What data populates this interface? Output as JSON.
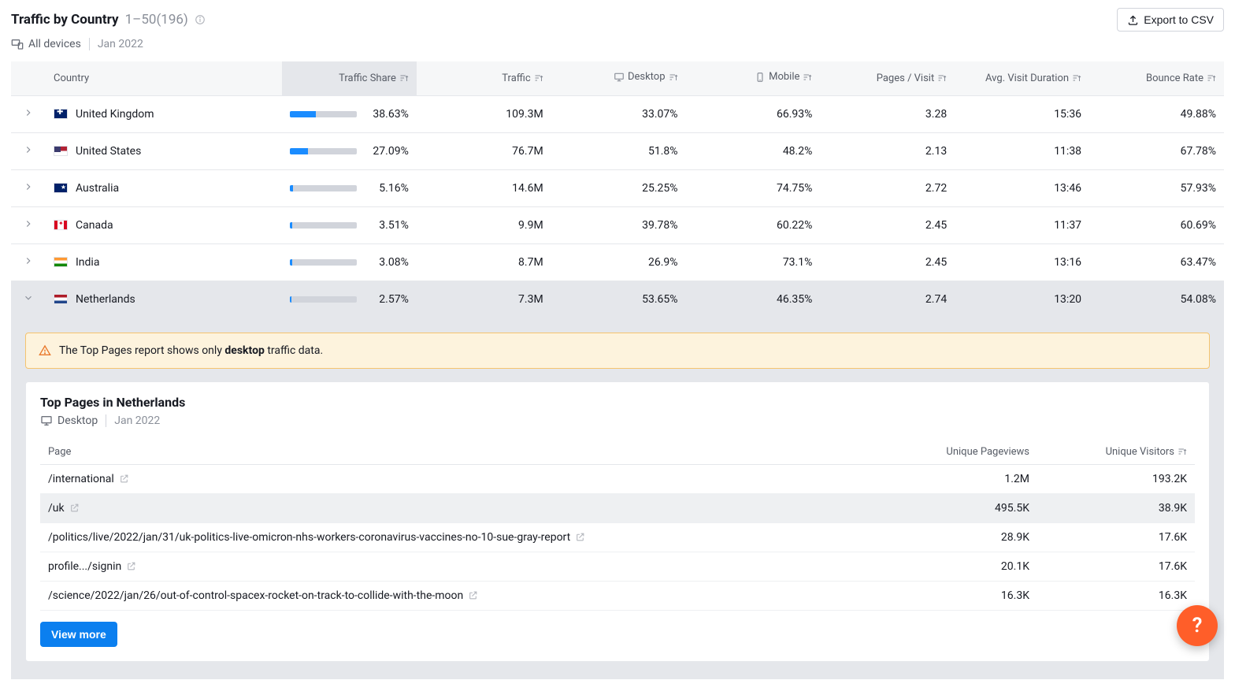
{
  "header": {
    "title": "Traffic by Country",
    "range": "1–50",
    "total": "(196)",
    "export_label": "Export to CSV",
    "device_label": "All devices",
    "date_label": "Jan 2022"
  },
  "columns": {
    "country": "Country",
    "share": "Traffic Share",
    "traffic": "Traffic",
    "desktop": "Desktop",
    "mobile": "Mobile",
    "pages_visit": "Pages / Visit",
    "avg_duration": "Avg. Visit Duration",
    "bounce": "Bounce Rate"
  },
  "rows": [
    {
      "flag": "gb",
      "country": "United Kingdom",
      "share_pct": 38.63,
      "share": "38.63%",
      "traffic": "109.3M",
      "desktop": "33.07%",
      "mobile": "66.93%",
      "pages_visit": "3.28",
      "avg_duration": "15:36",
      "bounce": "49.88%"
    },
    {
      "flag": "us",
      "country": "United States",
      "share_pct": 27.09,
      "share": "27.09%",
      "traffic": "76.7M",
      "desktop": "51.8%",
      "mobile": "48.2%",
      "pages_visit": "2.13",
      "avg_duration": "11:38",
      "bounce": "67.78%"
    },
    {
      "flag": "au",
      "country": "Australia",
      "share_pct": 5.16,
      "share": "5.16%",
      "traffic": "14.6M",
      "desktop": "25.25%",
      "mobile": "74.75%",
      "pages_visit": "2.72",
      "avg_duration": "13:46",
      "bounce": "57.93%"
    },
    {
      "flag": "ca",
      "country": "Canada",
      "share_pct": 3.51,
      "share": "3.51%",
      "traffic": "9.9M",
      "desktop": "39.78%",
      "mobile": "60.22%",
      "pages_visit": "2.45",
      "avg_duration": "11:37",
      "bounce": "60.69%"
    },
    {
      "flag": "in",
      "country": "India",
      "share_pct": 3.08,
      "share": "3.08%",
      "traffic": "8.7M",
      "desktop": "26.9%",
      "mobile": "73.1%",
      "pages_visit": "2.45",
      "avg_duration": "13:16",
      "bounce": "63.47%"
    },
    {
      "flag": "nl",
      "country": "Netherlands",
      "share_pct": 2.57,
      "share": "2.57%",
      "traffic": "7.3M",
      "desktop": "53.65%",
      "mobile": "46.35%",
      "pages_visit": "2.74",
      "avg_duration": "13:20",
      "bounce": "54.08%",
      "expanded": true
    }
  ],
  "alert": {
    "pre": "The Top Pages report shows only ",
    "bold": "desktop",
    "post": " traffic data."
  },
  "detail": {
    "title": "Top Pages in Netherlands",
    "device_label": "Desktop",
    "date_label": "Jan 2022",
    "columns": {
      "page": "Page",
      "pageviews": "Unique Pageviews",
      "visitors": "Unique Visitors"
    },
    "rows": [
      {
        "page": "/international",
        "pageviews": "1.2M",
        "visitors": "193.2K"
      },
      {
        "page": "/uk",
        "pageviews": "495.5K",
        "visitors": "38.9K",
        "hovered": true
      },
      {
        "page": "/politics/live/2022/jan/31/uk-politics-live-omicron-nhs-workers-coronavirus-vaccines-no-10-sue-gray-report",
        "pageviews": "28.9K",
        "visitors": "17.6K"
      },
      {
        "page": "profile.../signin",
        "pageviews": "20.1K",
        "visitors": "17.6K"
      },
      {
        "page": "/science/2022/jan/26/out-of-control-spacex-rocket-on-track-to-collide-with-the-moon",
        "pageviews": "16.3K",
        "visitors": "16.3K"
      }
    ],
    "view_more": "View more"
  },
  "help": "?"
}
